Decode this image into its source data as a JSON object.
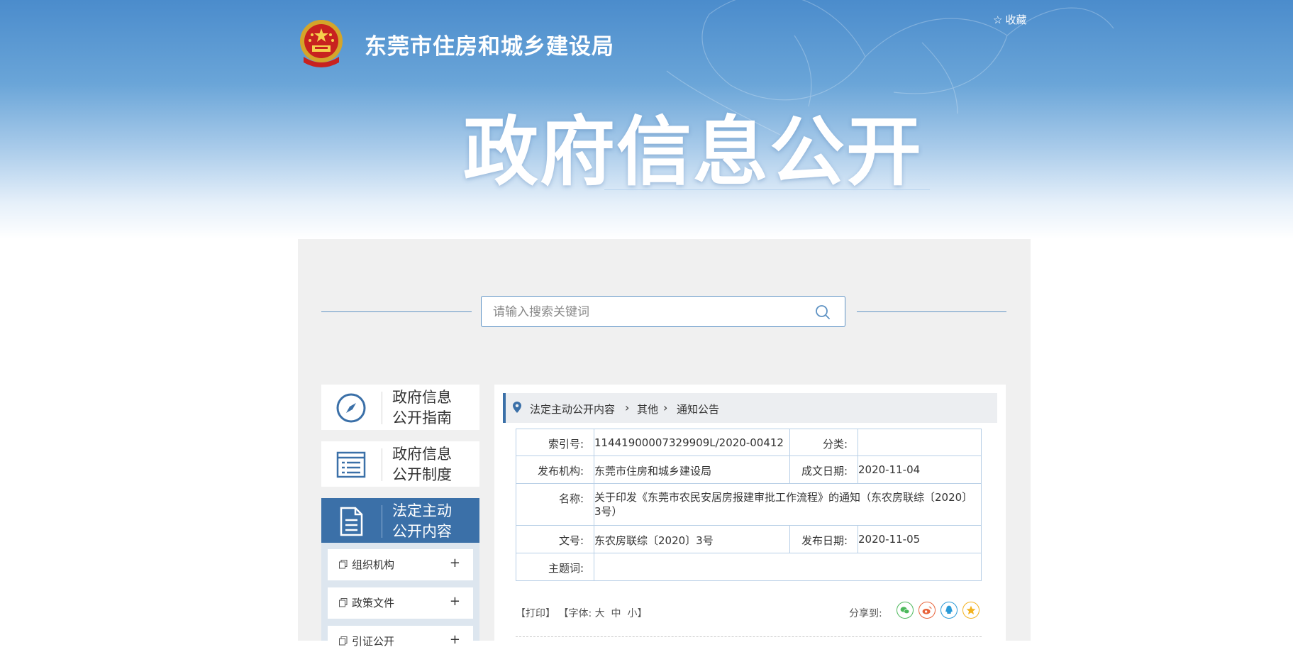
{
  "header": {
    "site_title": "东莞市住房和城乡建设局",
    "favorite_label": "收藏",
    "section_title": "政府信息公开"
  },
  "search": {
    "placeholder": "请输入搜索关键词",
    "value": ""
  },
  "left_nav": {
    "items": [
      {
        "line1": "政府信息",
        "line2": "公开指南",
        "icon": "compass-icon",
        "active": false
      },
      {
        "line1": "政府信息",
        "line2": "公开制度",
        "icon": "list-icon",
        "active": false
      },
      {
        "line1": "法定主动",
        "line2": "公开内容",
        "icon": "document-icon",
        "active": true
      }
    ],
    "subitems": [
      {
        "label": "组织机构",
        "expand": "+"
      },
      {
        "label": "政策文件",
        "expand": "+"
      },
      {
        "label": "引证公开",
        "expand": "+"
      }
    ]
  },
  "breadcrumb": {
    "items": [
      "法定主动公开内容",
      "其他",
      "通知公告"
    ]
  },
  "meta": {
    "index_label": "索引号:",
    "index_value": "11441900007329909L/2020-00412",
    "category_label": "分类:",
    "category_value": "",
    "publisher_label": "发布机构:",
    "publisher_value": "东莞市住房和城乡建设局",
    "created_label": "成文日期:",
    "created_value": "2020-11-04",
    "name_label": "名称:",
    "name_value": "关于印发《东莞市农民安居房报建审批工作流程》的通知（东农房联综〔2020〕3号）",
    "docno_label": "文号:",
    "docno_value": "东农房联综〔2020〕3号",
    "published_label": "发布日期:",
    "published_value": "2020-11-05",
    "subject_label": "主题词:",
    "subject_value": ""
  },
  "tools": {
    "print": "【打印】",
    "font_prefix": "【字体:",
    "font_large": "大",
    "font_medium": "中",
    "font_small": "小",
    "font_suffix": "】",
    "share_label": "分享到:"
  },
  "share": [
    {
      "icon": "wechat-icon",
      "color": "#4cb85b"
    },
    {
      "icon": "weibo-icon",
      "color": "#e8633a"
    },
    {
      "icon": "qq-icon",
      "color": "#2a9ad7"
    },
    {
      "icon": "qzone-icon",
      "color": "#f3b21f"
    }
  ],
  "colors": {
    "accent": "#3b70a8",
    "banner_top": "#4b8ccc"
  }
}
